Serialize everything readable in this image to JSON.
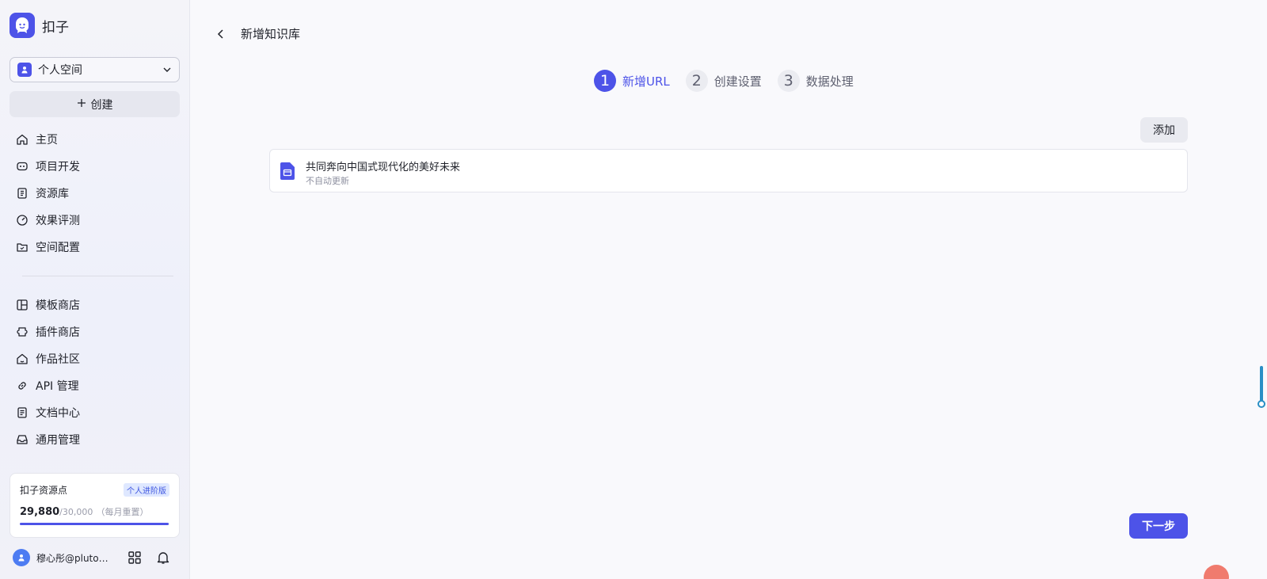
{
  "app": {
    "name": "扣子"
  },
  "sidebar": {
    "space_select": "个人空间",
    "create_label": "创建",
    "nav_primary": [
      {
        "label": "主页",
        "icon": "home-icon"
      },
      {
        "label": "项目开发",
        "icon": "robot-icon"
      },
      {
        "label": "资源库",
        "icon": "library-icon"
      },
      {
        "label": "效果评测",
        "icon": "gauge-icon"
      },
      {
        "label": "空间配置",
        "icon": "folder-settings-icon"
      }
    ],
    "nav_secondary": [
      {
        "label": "模板商店",
        "icon": "template-icon"
      },
      {
        "label": "插件商店",
        "icon": "plugin-icon"
      },
      {
        "label": "作品社区",
        "icon": "community-icon"
      },
      {
        "label": "API 管理",
        "icon": "link-icon"
      },
      {
        "label": "文档中心",
        "icon": "document-icon"
      },
      {
        "label": "通用管理",
        "icon": "inbox-icon"
      }
    ],
    "points": {
      "title": "扣子资源点",
      "badge": "个人进阶版",
      "value": "29,880",
      "total": "/30,000",
      "reset": "（每月重置）",
      "fraction": 0.996
    },
    "user": {
      "name": "穆心彤@pluto…"
    }
  },
  "header": {
    "title": "新增知识库"
  },
  "steps": [
    {
      "num": "1",
      "label": "新增URL",
      "state": "active"
    },
    {
      "num": "2",
      "label": "创建设置",
      "state": "inactive"
    },
    {
      "num": "3",
      "label": "数据处理",
      "state": "inactive"
    }
  ],
  "actions": {
    "add_label": "添加",
    "next_label": "下一步"
  },
  "url_item": {
    "title": "共同奔向中国式现代化的美好未来",
    "subtitle": "不自动更新"
  },
  "colors": {
    "accent": "#4d53e8",
    "text": "#1f2129",
    "muted": "#8e90a0"
  }
}
